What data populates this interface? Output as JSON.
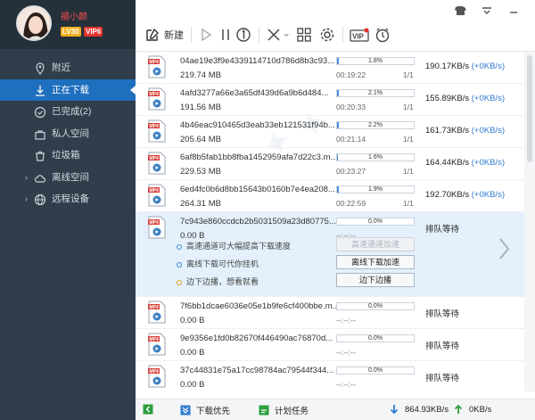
{
  "profile": {
    "username": "褪小颜",
    "level": "LV30",
    "vip": "VIP6"
  },
  "nav": [
    {
      "label": "附近",
      "icon": "location-icon"
    },
    {
      "label": "正在下载",
      "icon": "download-icon",
      "active": true
    },
    {
      "label": "已完成(2)",
      "icon": "check-circle-icon"
    },
    {
      "label": "私人空间",
      "icon": "briefcase-icon"
    },
    {
      "label": "垃圾箱",
      "icon": "trash-icon"
    },
    {
      "label": "离线空间",
      "icon": "cloud-icon",
      "expand": true
    },
    {
      "label": "远程设备",
      "icon": "globe-icon",
      "expand": true
    }
  ],
  "toolbar": {
    "new_label": "新建"
  },
  "downloads": [
    {
      "name": "04ae19e3f9e4339114710d786d8b3c93...",
      "size": "219.74 MB",
      "pct": "1.8%",
      "progress": 0.018,
      "eta": "00:19:22",
      "count": "1/1",
      "speed": "190.17KB/s",
      "plus": "(+0KB/s)"
    },
    {
      "name": "4afd3277a66e3a65df439d6a9b6d484...",
      "size": "191.56 MB",
      "pct": "2.1%",
      "progress": 0.021,
      "eta": "00:20:33",
      "count": "1/1",
      "speed": "155.89KB/s",
      "plus": "(+0KB/s)"
    },
    {
      "name": "4b46eac910465d3eab33eb121531f94b...",
      "size": "205.64 MB",
      "pct": "2.2%",
      "progress": 0.022,
      "eta": "00:21:14",
      "count": "1/1",
      "speed": "161.73KB/s",
      "plus": "(+0KB/s)"
    },
    {
      "name": "6af8b5fab1bb8fba1452959afa7d22c3.m...",
      "size": "229.53 MB",
      "pct": "1.6%",
      "progress": 0.016,
      "eta": "00:23:27",
      "count": "1/1",
      "speed": "164.44KB/s",
      "plus": "(+0KB/s)"
    },
    {
      "name": "6ed4fc0b6d8bb15643b0160b7e4ea208...",
      "size": "264.31 MB",
      "pct": "1.9%",
      "progress": 0.019,
      "eta": "00:22:59",
      "count": "1/1",
      "speed": "192.70KB/s",
      "plus": "(+0KB/s)"
    }
  ],
  "selected": {
    "name": "7c943e860ccdcb2b5031509a23d80775...",
    "size": "0.00 B",
    "pct": "0.0%",
    "eta": "--:--:--",
    "status": "排队等待",
    "options": [
      {
        "text": "高速通道可大幅提高下载速度",
        "button": "高速通道加速",
        "disabled": true
      },
      {
        "text": "离线下载可代你挂机",
        "button": "离线下载加速",
        "disabled": false
      },
      {
        "text": "边下边播，想看就看",
        "button": "边下边播",
        "disabled": false
      }
    ]
  },
  "queued": [
    {
      "name": "7f6bb1dcae6036e05e1b9fe6cf400bbe.m...",
      "size": "0.00 B",
      "pct": "0.0%",
      "eta": "--:--:--",
      "status": "排队等待"
    },
    {
      "name": "9e9356e1fd0b82670f446490ac76870d...",
      "size": "0.00 B",
      "pct": "0.0%",
      "eta": "--:--:--",
      "status": "排队等待"
    },
    {
      "name": "37c44831e75a17cc98784ac79544f344...",
      "size": "0.00 B",
      "pct": "0.0%",
      "eta": "--:--:--",
      "status": "排队等待"
    }
  ],
  "statusbar": {
    "priority": "下载优先",
    "schedule": "计划任务",
    "down_speed": "864.93KB/s",
    "up_speed": "0KB/s"
  },
  "colors": {
    "sidebar": "#2f3e4a",
    "active": "#1f6fbf",
    "selected_row": "#e4f0fb",
    "progress": "#4a90d9"
  }
}
